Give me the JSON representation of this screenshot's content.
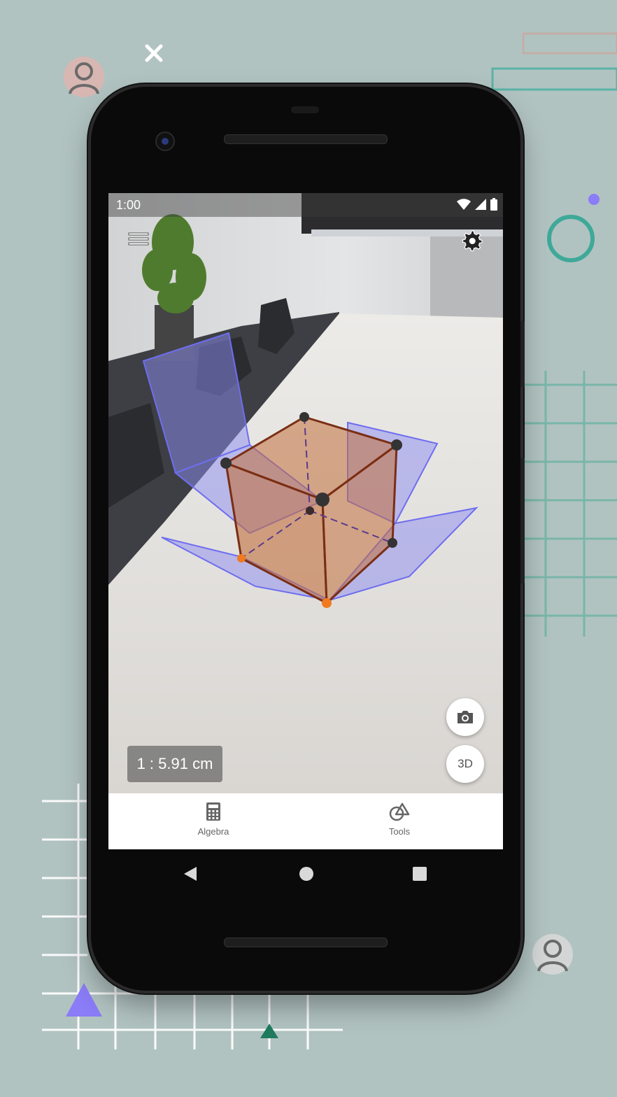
{
  "status_bar": {
    "time": "1:00",
    "icons": [
      "wifi-icon",
      "signal-icon",
      "battery-icon"
    ]
  },
  "toolbar": {
    "menu_icon": "menu-icon",
    "settings_icon": "gear-icon"
  },
  "ar": {
    "scale_label": "1 : 5.91 cm",
    "camera_icon": "camera-icon",
    "view_3d_label": "3D"
  },
  "bottom_nav": {
    "items": [
      {
        "label": "Algebra",
        "icon": "calculator-icon"
      },
      {
        "label": "Tools",
        "icon": "shapes-icon"
      }
    ]
  },
  "system_nav": [
    "back-icon",
    "home-icon",
    "recents-icon"
  ],
  "decorations": {
    "close_icon": "close-icon",
    "avatar_icons": [
      "avatar-icon",
      "avatar-icon"
    ]
  },
  "colors": {
    "background": "#b1c3c1",
    "net_fill": "#8c8cf2",
    "cube_fill": "#c2703d",
    "accent_teal": "#3fa999",
    "accent_purple": "#8b7cf7"
  }
}
